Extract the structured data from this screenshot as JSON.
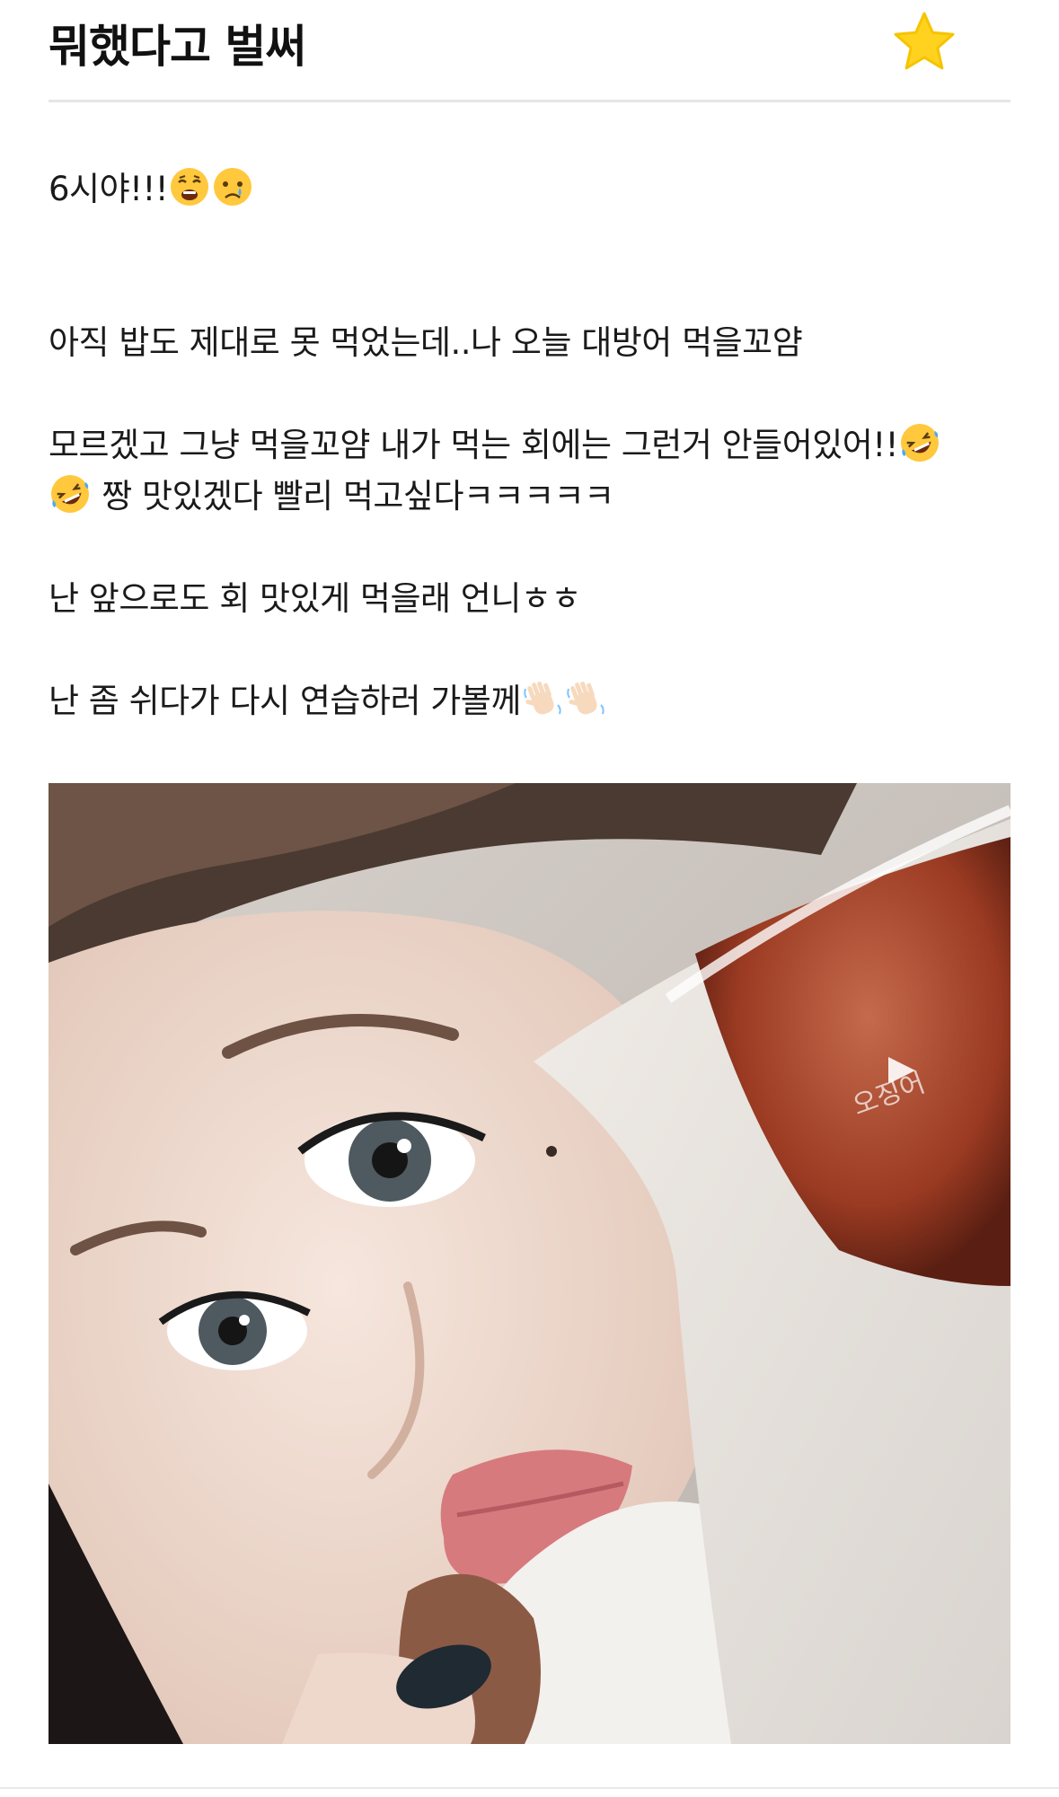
{
  "post": {
    "title": "뭐했다고 벌써",
    "favorite_icon": "star-icon",
    "favorite_color": "#FFD21F",
    "paragraphs": {
      "p1": "6시야!!!",
      "p2": "아직 밥도 제대로 못 먹었는데..나 오늘 대방어 먹을꼬얌",
      "p3a": "모르겠고 그냥 먹을꼬얌 내가 먹는 회에는 그런거 안들어있어!!",
      "p3b": " 짱 맛있겠다 빨리 먹고싶다ㅋㅋㅋㅋㅋ",
      "p4": "난 앞으로도 회 맛있게 먹을래 언니ㅎㅎ",
      "p5": "난 좀 쉬다가 다시 연습하러 가볼께"
    },
    "emojis": {
      "weary": "weary-face-icon",
      "crying": "crying-face-icon",
      "rofl": "rolling-on-floor-laughing-icon",
      "wave": "waving-hand-icon"
    },
    "photo": {
      "subject": "selfie-photo",
      "package_label": "오징어"
    }
  }
}
